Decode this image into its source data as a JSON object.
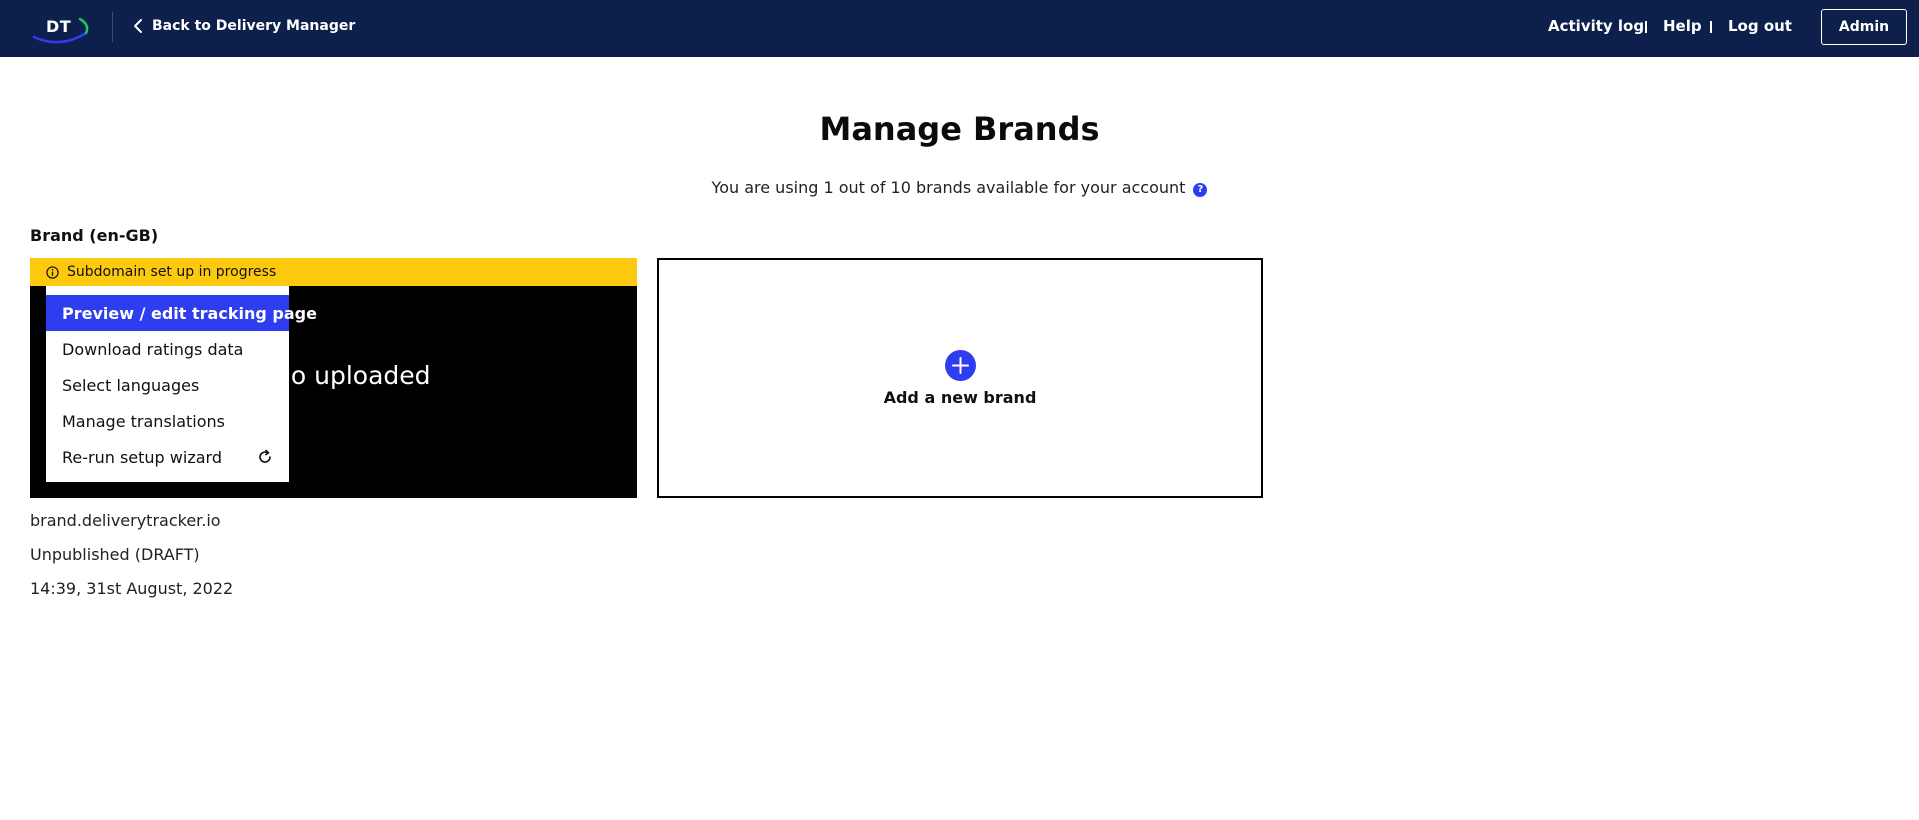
{
  "header": {
    "logo_text": "DT",
    "back_label": "Back to Delivery Manager",
    "nav": [
      "Activity log",
      "Help",
      "Log out"
    ],
    "admin_label": "Admin"
  },
  "page": {
    "title": "Manage Brands",
    "subtitle": "You are using 1 out of 10 brands available for your account",
    "help_glyph": "?"
  },
  "brand": {
    "label": "Brand (en-GB)",
    "banner_text": "Subdomain set up in progress",
    "logo_placeholder": "go uploaded",
    "domain": "brand.deliverytracker.io",
    "status": "Unpublished (DRAFT)",
    "timestamp": "14:39, 31st August, 2022"
  },
  "menu": {
    "items": [
      "Preview / edit tracking page",
      "Download ratings data",
      "Select languages",
      "Manage translations",
      "Re-run setup wizard"
    ],
    "active_index": 0
  },
  "add_brand": {
    "label": "Add a new brand"
  },
  "colors": {
    "header_bg": "#0d1f4b",
    "accent": "#2f3df0",
    "banner": "#fcc90e",
    "logo_swoosh_blue": "#2f3df0",
    "logo_swoosh_green": "#22c55e"
  },
  "icons": {
    "back": "chevron-left-icon",
    "help": "question-circle-icon",
    "info": "info-circle-icon",
    "refresh": "refresh-icon",
    "add": "plus-circle-icon"
  }
}
